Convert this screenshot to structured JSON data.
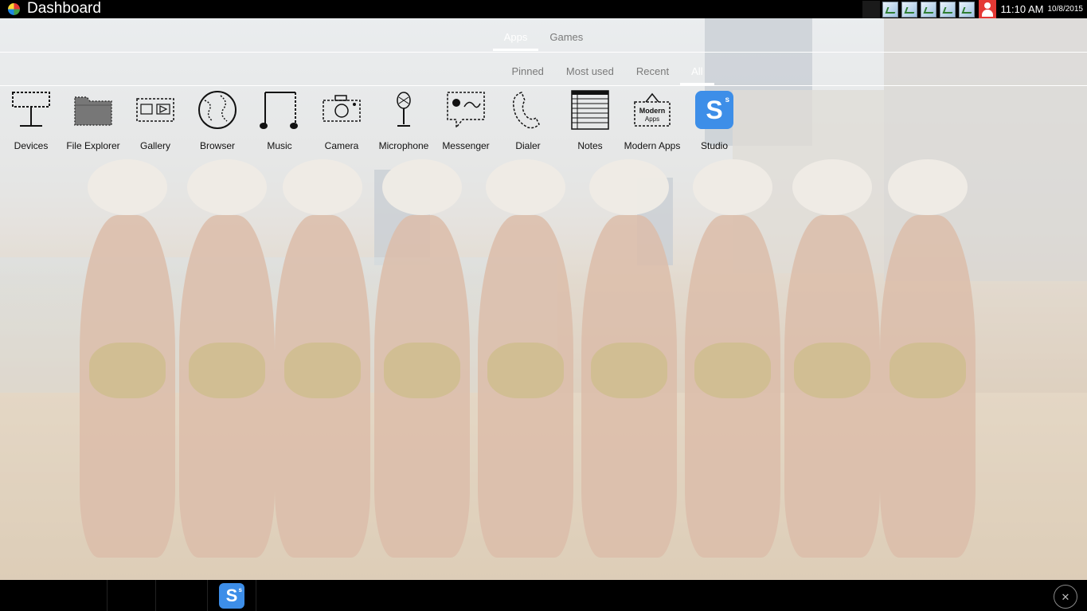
{
  "window": {
    "title": "Dashboard"
  },
  "tray": {
    "time": "11:10 AM",
    "date": "10/8/2015"
  },
  "tabs_primary": [
    {
      "label": "Apps",
      "active": true
    },
    {
      "label": "Games",
      "active": false
    }
  ],
  "tabs_secondary": [
    {
      "label": "Pinned",
      "active": false
    },
    {
      "label": "Most used",
      "active": false
    },
    {
      "label": "Recent",
      "active": false
    },
    {
      "label": "All",
      "active": true
    }
  ],
  "apps": [
    {
      "label": "Devices",
      "icon": "devices-icon"
    },
    {
      "label": "File Explorer",
      "icon": "folder-icon"
    },
    {
      "label": "Gallery",
      "icon": "gallery-icon"
    },
    {
      "label": "Browser",
      "icon": "globe-icon"
    },
    {
      "label": "Music",
      "icon": "music-note-icon"
    },
    {
      "label": "Camera",
      "icon": "camera-icon"
    },
    {
      "label": "Microphone",
      "icon": "microphone-icon"
    },
    {
      "label": "Messenger",
      "icon": "chat-icon"
    },
    {
      "label": "Dialer",
      "icon": "phone-icon"
    },
    {
      "label": "Notes",
      "icon": "notes-icon"
    },
    {
      "label": "Modern Apps",
      "icon": "modern-apps-icon",
      "icon_text": "Modern Apps"
    },
    {
      "label": "Studio",
      "icon": "studio-icon",
      "icon_text": "S",
      "icon_sup": "s"
    }
  ],
  "taskbar": {
    "studio_text": "S",
    "studio_sup": "s",
    "close_text": "✕"
  },
  "colors": {
    "studio_blue": "#3d8ee8",
    "tray_user_red": "#e53935",
    "bar_black": "#000000"
  }
}
